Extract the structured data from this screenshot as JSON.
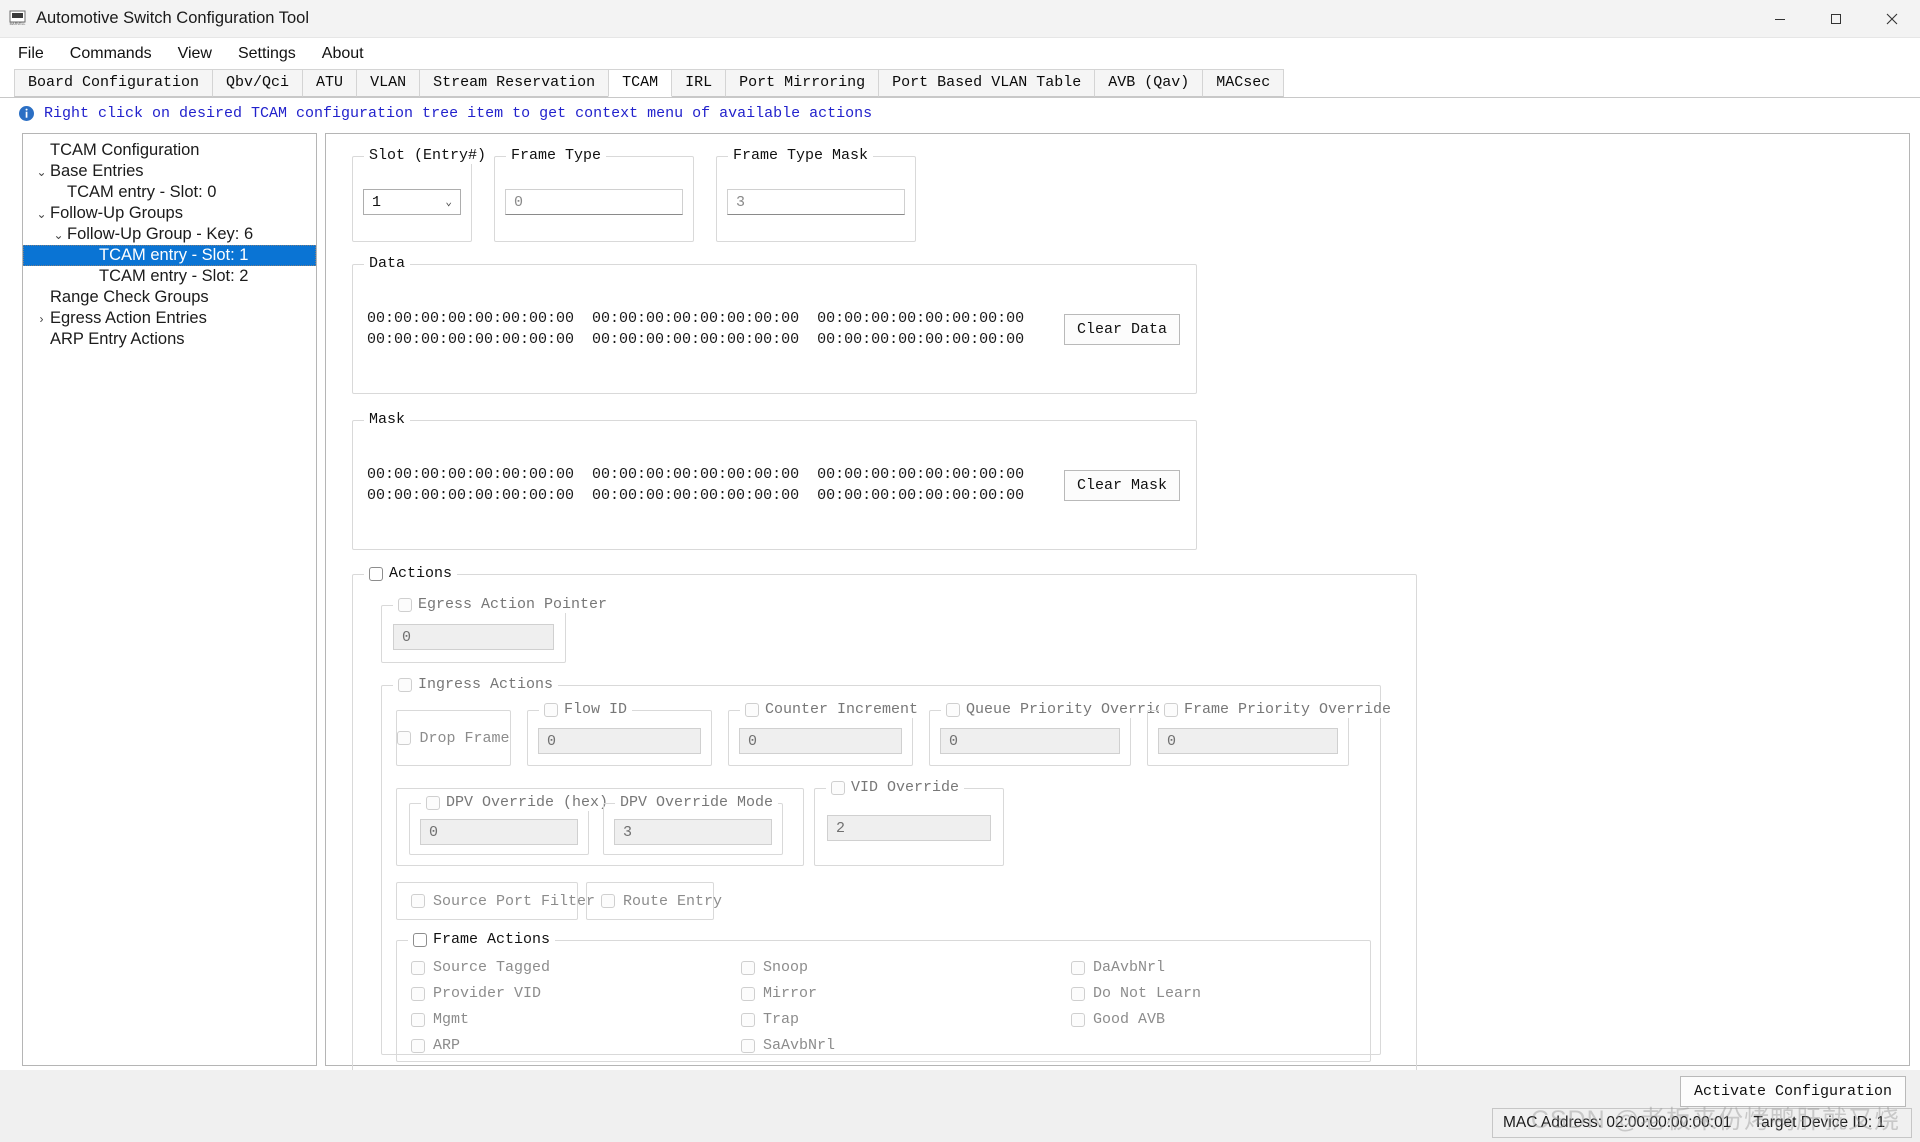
{
  "window": {
    "title": "Automotive Switch Configuration Tool",
    "logo_icon": "marvell-logo-icon",
    "minimize_icon": "minimize-icon",
    "maximize_icon": "maximize-icon",
    "close_icon": "close-icon"
  },
  "menubar": {
    "items": [
      "File",
      "Commands",
      "View",
      "Settings",
      "About"
    ]
  },
  "tabs": {
    "items": [
      "Board Configuration",
      "Qbv/Qci",
      "ATU",
      "VLAN",
      "Stream Reservation",
      "TCAM",
      "IRL",
      "Port Mirroring",
      "Port Based VLAN Table",
      "AVB (Qav)",
      "MACsec"
    ],
    "active": "TCAM"
  },
  "hint": {
    "icon": "info-icon",
    "text": "Right click on desired TCAM configuration tree item to get context menu of available actions",
    "color": "#2222cc"
  },
  "tree": {
    "root": "TCAM Configuration",
    "items": [
      {
        "label": "TCAM Configuration",
        "level": 0,
        "twisty": "",
        "selected": false
      },
      {
        "label": "Base Entries",
        "level": 1,
        "twisty": "v",
        "selected": false
      },
      {
        "label": "TCAM entry - Slot: 0",
        "level": 2,
        "twisty": "",
        "selected": false
      },
      {
        "label": "Follow-Up Groups",
        "level": 1,
        "twisty": "v",
        "selected": false
      },
      {
        "label": "Follow-Up Group - Key: 6",
        "level": 2,
        "twisty": "v",
        "selected": false
      },
      {
        "label": "TCAM entry - Slot: 1",
        "level": 3,
        "twisty": "",
        "selected": true
      },
      {
        "label": "TCAM entry - Slot: 2",
        "level": 3,
        "twisty": "",
        "selected": false
      },
      {
        "label": "Range Check Groups",
        "level": 1,
        "twisty": "",
        "selected": false
      },
      {
        "label": "Egress Action Entries",
        "level": 1,
        "twisty": ">",
        "selected": false
      },
      {
        "label": "ARP Entry Actions",
        "level": 1,
        "twisty": "",
        "selected": false
      }
    ],
    "selection_color": "#0a74d4"
  },
  "form": {
    "slot": {
      "label": "Slot (Entry#)",
      "value": "1",
      "caret_icon": "chevron-down-icon"
    },
    "frame_type": {
      "label": "Frame Type",
      "value": "0"
    },
    "frame_type_mask": {
      "label": "Frame Type Mask",
      "value": "3"
    },
    "data": {
      "label": "Data",
      "rows": [
        "00:00:00:00:00:00:00:00  00:00:00:00:00:00:00:00  00:00:00:00:00:00:00:00",
        "00:00:00:00:00:00:00:00  00:00:00:00:00:00:00:00  00:00:00:00:00:00:00:00"
      ],
      "clear_button": "Clear Data"
    },
    "mask": {
      "label": "Mask",
      "rows": [
        "00:00:00:00:00:00:00:00  00:00:00:00:00:00:00:00  00:00:00:00:00:00:00:00",
        "00:00:00:00:00:00:00:00  00:00:00:00:00:00:00:00  00:00:00:00:00:00:00:00"
      ],
      "clear_button": "Clear Mask"
    },
    "actions": {
      "label": "Actions",
      "checked": false,
      "egress_action_pointer": {
        "label": "Egress Action Pointer",
        "value": "0",
        "checked": false
      },
      "ingress_actions": {
        "label": "Ingress Actions",
        "checked": false,
        "drop_frame": {
          "label": "Drop Frame",
          "checked": false
        },
        "flow_id": {
          "label": "Flow ID",
          "value": "0",
          "checked": false
        },
        "counter_increment": {
          "label": "Counter Increment",
          "value": "0",
          "checked": false
        },
        "queue_priority_override": {
          "label": "Queue Priority Override",
          "value": "0",
          "checked": false
        },
        "frame_priority_override": {
          "label": "Frame Priority Override",
          "value": "0",
          "checked": false
        },
        "dpv_override_hex": {
          "label": "DPV Override (hex)",
          "value": "0",
          "checked": false
        },
        "dpv_override_mode": {
          "label": "DPV Override Mode",
          "value": "3"
        },
        "vid_override": {
          "label": "VID Override",
          "value": "2",
          "checked": false
        },
        "source_port_filter": {
          "label": "Source Port Filter",
          "checked": false
        },
        "route_entry": {
          "label": "Route Entry",
          "checked": false
        },
        "frame_actions": {
          "label": "Frame Actions",
          "checked": false,
          "columns": [
            [
              {
                "label": "Source Tagged",
                "checked": false
              },
              {
                "label": "Provider VID",
                "checked": false
              },
              {
                "label": "Mgmt",
                "checked": false
              },
              {
                "label": "ARP",
                "checked": false
              }
            ],
            [
              {
                "label": "Snoop",
                "checked": false
              },
              {
                "label": "Mirror",
                "checked": false
              },
              {
                "label": "Trap",
                "checked": false
              },
              {
                "label": "SaAvbNrl",
                "checked": false
              }
            ],
            [
              {
                "label": "DaAvbNrl",
                "checked": false
              },
              {
                "label": "Do Not Learn",
                "checked": false
              },
              {
                "label": "Good AVB",
                "checked": false
              }
            ]
          ]
        }
      }
    }
  },
  "footer": {
    "activate_button": "Activate Configuration",
    "mac_address": "MAC Address: 02:00:00:00:00:01",
    "target_device": "Target Device ID: 1",
    "watermark": "CSDN @老板来份烤鸭肝就又烧"
  }
}
